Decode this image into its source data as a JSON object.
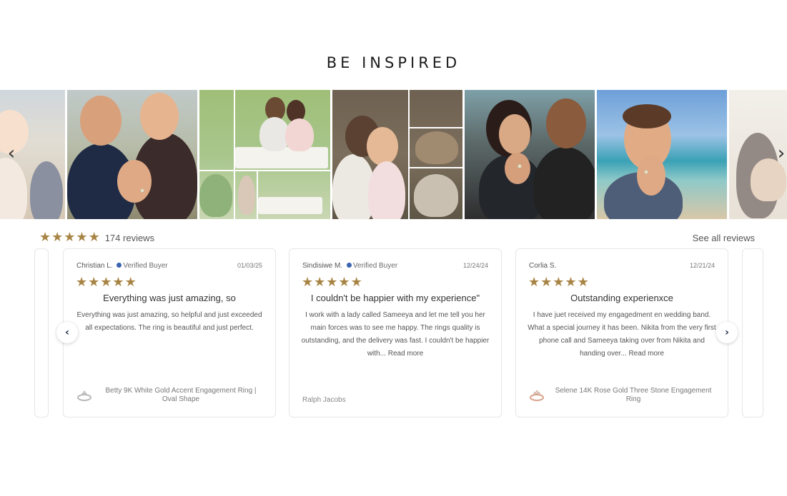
{
  "section": {
    "title": "BE INSPIRED"
  },
  "photos": [
    {
      "name": "couple-beach-partial"
    },
    {
      "name": "couple-ring-showing"
    },
    {
      "name": "picnic-proposal-collage"
    },
    {
      "name": "forest-proposal-collage"
    },
    {
      "name": "car-selfie-ring"
    },
    {
      "name": "beach-man-ring"
    },
    {
      "name": "hands-ring-partial"
    }
  ],
  "icons": {
    "prev": "chevron-left-icon",
    "next": "chevron-right-icon",
    "star": "star-icon",
    "verified": "verified-badge-icon",
    "ring": "ring-icon"
  },
  "summary": {
    "rating_stars": 5,
    "review_count": "174 reviews",
    "see_all": "See all reviews"
  },
  "colors": {
    "star": "#a88444",
    "verified_badge": "#3a63b0"
  },
  "reviews": [
    {
      "name": "Christian L.",
      "verified": "Verified Buyer",
      "date": "01/03/25",
      "stars": 5,
      "title": "Everything was just amazing, so",
      "body": "Everything was just amazing, so helpful and just exceeded all expectations. The ring is beautiful and just perfect.",
      "read_more": "",
      "product": "Betty 9K White Gold Accent Engagement Ring | Oval Shape"
    },
    {
      "name": "Sindisiwe M.",
      "verified": "Verified Buyer",
      "date": "12/24/24",
      "stars": 5,
      "title": "I couldn't be happier with my experience\"",
      "body": "I work with a lady called Sameeya and let me tell you her main forces was to see me happy. The rings quality is outstanding, and the delivery was fast. I couldn't be happier with...",
      "read_more": "Read more",
      "author": "Ralph Jacobs"
    },
    {
      "name": "Corlia S.",
      "verified": "",
      "date": "12/21/24",
      "stars": 5,
      "title": "Outstanding experienxce",
      "body": "I have juet received my engagedment en wedding band. What a special journey it has been. Nikita from the very first phone call and Sameeya taking over from Nikita and handing over...",
      "read_more": "Read more",
      "product": "Selene 14K Rose Gold Three Stone Engagement Ring"
    }
  ]
}
